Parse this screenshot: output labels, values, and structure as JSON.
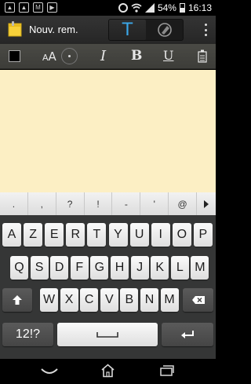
{
  "status_bar": {
    "notification_icons": [
      "image-icon",
      "image-icon",
      "gmail-icon",
      "play-store-icon"
    ],
    "status_icons": [
      "alarm-icon",
      "wifi-icon",
      "signal-icon"
    ],
    "battery_percent": 54,
    "battery_label": "54%",
    "time": "16:13"
  },
  "action_bar": {
    "title": "Nouv. rem.",
    "mode_text_label": "T",
    "mode_active": "text"
  },
  "format_toolbar": {
    "text_color": "#000000",
    "font_size_label_small": "A",
    "font_size_label_big": "A",
    "italic_label": "I",
    "bold_label": "B",
    "underline_label": "U"
  },
  "note": {
    "content": "",
    "background_color": "#fcefc4"
  },
  "keyboard": {
    "suggestions": [
      ".",
      ",",
      "?",
      "!",
      "-",
      "'",
      "@"
    ],
    "row1": [
      "A",
      "Z",
      "E",
      "R",
      "T",
      "Y",
      "U",
      "I",
      "O",
      "P"
    ],
    "row2": [
      "Q",
      "S",
      "D",
      "F",
      "G",
      "H",
      "J",
      "K",
      "L",
      "M"
    ],
    "row3": [
      "W",
      "X",
      "C",
      "V",
      "B",
      "N",
      "M"
    ],
    "symbols_label": "12!?"
  },
  "colors": {
    "accent": "#3ba8ea",
    "note_paper": "#fcefc4"
  }
}
